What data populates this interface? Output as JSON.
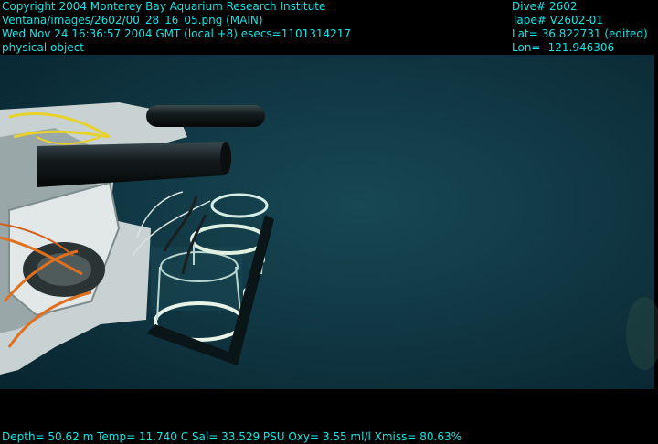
{
  "overlay": {
    "top_left": [
      "Copyright 2004 Monterey Bay Aquarium Research Institute",
      "Ventana/images/2602/00_28_16_05.png (MAIN)",
      "Wed Nov 24 16:36:57 2004 GMT (local +8)  esecs=1101314217",
      "physical object"
    ],
    "top_right": [
      "Dive# 2602",
      "Tape# V2602-01",
      "Lat= 36.822731 (edited)",
      "Lon= -121.946306"
    ],
    "bottom": "Depth= 50.62 m  Temp= 11.740 C  Sal= 33.529 PSU  Oxy= 3.55 ml/l  Xmiss= 80.63%"
  },
  "colors": {
    "overlay_text": "#19e3e6",
    "water_deep": "#0a2a34",
    "water_light": "#164350",
    "frame": "#000000"
  },
  "scene": {
    "subject": "ROV sampling equipment with cylindrical samplers",
    "icons": [
      "rov-equipment",
      "sampling-cylinders",
      "cables"
    ]
  }
}
